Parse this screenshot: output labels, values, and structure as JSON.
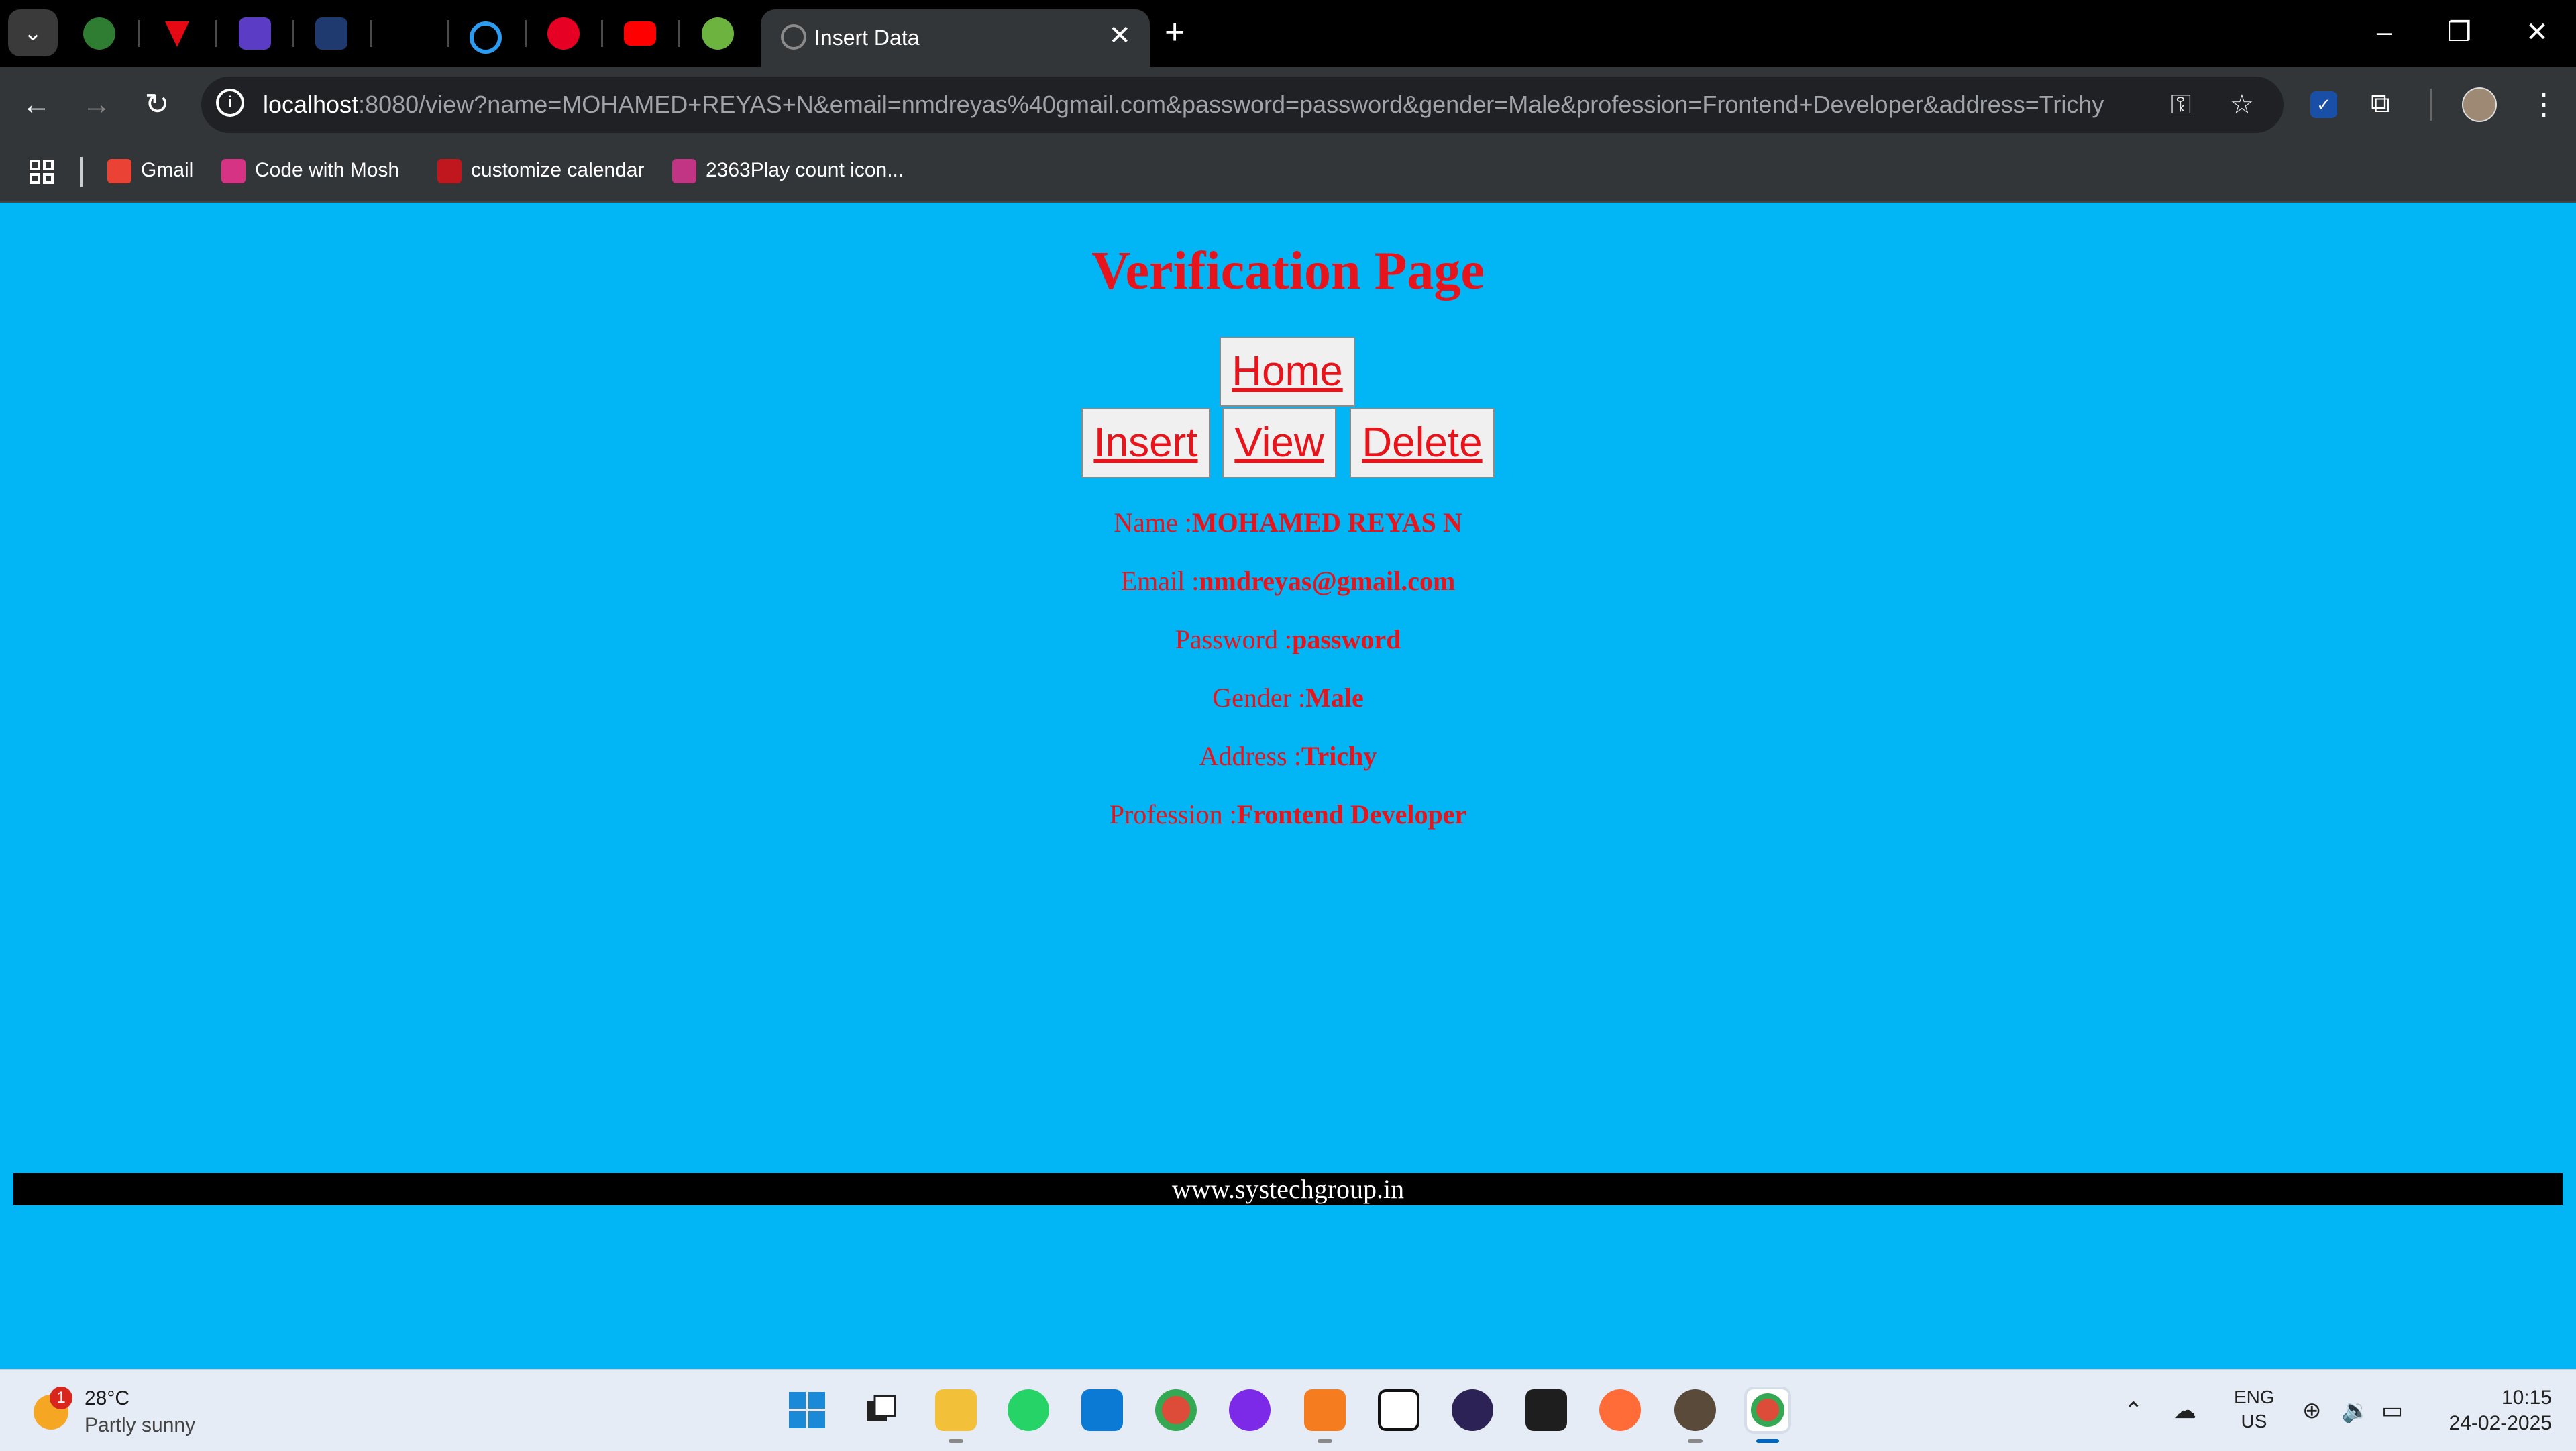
{
  "browser": {
    "active_tab_title": "Insert Data",
    "url_host": "localhost",
    "url_rest": ":8080/view?name=MOHAMED+REYAS+N&email=nmdreyas%40gmail.com&password=password&gender=Male&profession=Frontend+Developer&address=Trichy",
    "bookmarks": [
      "Gmail",
      "Code with Mosh",
      "customize calendar",
      "2363Play count icon..."
    ]
  },
  "page": {
    "title": "Verification Page",
    "nav": {
      "home": "Home",
      "insert": "Insert",
      "view": "View",
      "delete": "Delete"
    },
    "fields": [
      {
        "label": "Name :",
        "value": "MOHAMED REYAS N"
      },
      {
        "label": "Email :",
        "value": "nmdreyas@gmail.com"
      },
      {
        "label": "Password :",
        "value": "password"
      },
      {
        "label": "Gender :",
        "value": "Male"
      },
      {
        "label": "Address :",
        "value": "Trichy"
      },
      {
        "label": "Profession :",
        "value": "Frontend Developer"
      }
    ],
    "footer": "www.systechgroup.in"
  },
  "taskbar": {
    "weather_badge": "1",
    "temperature": "28°C",
    "condition": "Partly sunny",
    "lang_1": "ENG",
    "lang_2": "US",
    "time": "10:15",
    "date": "24-02-2025"
  },
  "colors": {
    "page_bg": "#02b5f5",
    "accent_red": "#e8141b",
    "footer_bg": "#000000"
  }
}
